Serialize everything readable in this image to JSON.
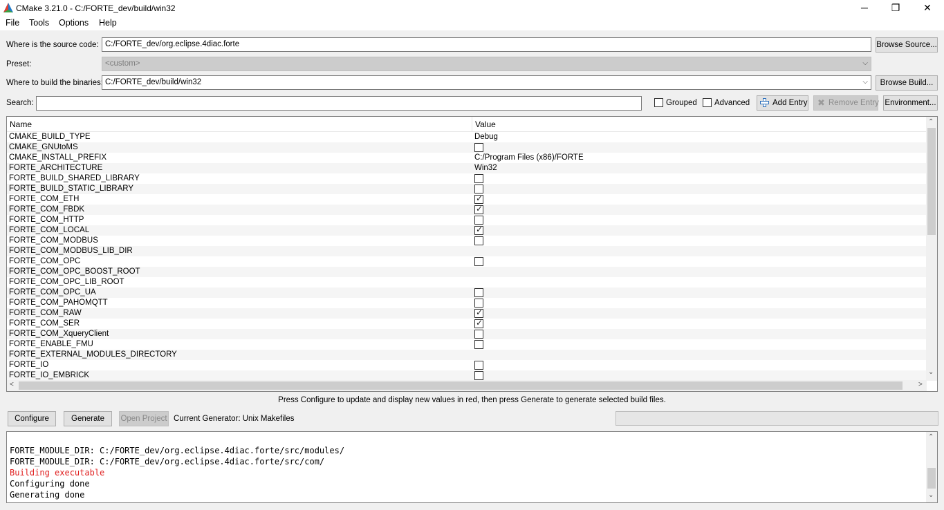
{
  "window": {
    "title": "CMake 3.21.0 - C:/FORTE_dev/build/win32"
  },
  "menu": [
    "File",
    "Tools",
    "Options",
    "Help"
  ],
  "source": {
    "label": "Where is the source code:",
    "value": "C:/FORTE_dev/org.eclipse.4diac.forte",
    "button": "Browse Source..."
  },
  "preset": {
    "label": "Preset:",
    "value": "<custom>"
  },
  "build": {
    "label": "Where to build the binaries:",
    "value": "C:/FORTE_dev/build/win32",
    "button": "Browse Build..."
  },
  "search": {
    "label": "Search:",
    "value": ""
  },
  "toolbar": {
    "grouped": "Grouped",
    "advanced": "Advanced",
    "add_entry": "Add Entry",
    "remove_entry": "Remove Entry",
    "environment": "Environment..."
  },
  "table": {
    "headers": {
      "name": "Name",
      "value": "Value"
    },
    "rows": [
      {
        "name": "CMAKE_BUILD_TYPE",
        "value": "Debug"
      },
      {
        "name": "CMAKE_GNUtoMS",
        "check": false
      },
      {
        "name": "CMAKE_INSTALL_PREFIX",
        "value": "C:/Program Files (x86)/FORTE"
      },
      {
        "name": "FORTE_ARCHITECTURE",
        "value": "Win32"
      },
      {
        "name": "FORTE_BUILD_SHARED_LIBRARY",
        "check": false
      },
      {
        "name": "FORTE_BUILD_STATIC_LIBRARY",
        "check": false
      },
      {
        "name": "FORTE_COM_ETH",
        "check": true
      },
      {
        "name": "FORTE_COM_FBDK",
        "check": true
      },
      {
        "name": "FORTE_COM_HTTP",
        "check": false
      },
      {
        "name": "FORTE_COM_LOCAL",
        "check": true
      },
      {
        "name": "FORTE_COM_MODBUS",
        "check": false
      },
      {
        "name": "FORTE_COM_MODBUS_LIB_DIR",
        "value": ""
      },
      {
        "name": "FORTE_COM_OPC",
        "check": false
      },
      {
        "name": "FORTE_COM_OPC_BOOST_ROOT",
        "value": ""
      },
      {
        "name": "FORTE_COM_OPC_LIB_ROOT",
        "value": ""
      },
      {
        "name": "FORTE_COM_OPC_UA",
        "check": false
      },
      {
        "name": "FORTE_COM_PAHOMQTT",
        "check": false
      },
      {
        "name": "FORTE_COM_RAW",
        "check": true
      },
      {
        "name": "FORTE_COM_SER",
        "check": true
      },
      {
        "name": "FORTE_COM_XqueryClient",
        "check": false
      },
      {
        "name": "FORTE_ENABLE_FMU",
        "check": false
      },
      {
        "name": "FORTE_EXTERNAL_MODULES_DIRECTORY",
        "value": ""
      },
      {
        "name": "FORTE_IO",
        "check": false
      },
      {
        "name": "FORTE_IO_EMBRICK",
        "check": false
      }
    ]
  },
  "hint": "Press Configure to update and display new values in red, then press Generate to generate selected build files.",
  "actions": {
    "configure": "Configure",
    "generate": "Generate",
    "open_project": "Open Project",
    "generator": "Current Generator: Unix Makefiles"
  },
  "log": [
    {
      "text": "FORTE_MODULE_DIR: C:/FORTE_dev/org.eclipse.4diac.forte/src/modules/",
      "error": false
    },
    {
      "text": "FORTE_MODULE_DIR: C:/FORTE_dev/org.eclipse.4diac.forte/src/com/",
      "error": false
    },
    {
      "text": "Building executable",
      "error": true
    },
    {
      "text": "Configuring done",
      "error": false
    },
    {
      "text": "Generating done",
      "error": false
    }
  ],
  "colors": {
    "error_text": "#e02020",
    "add_icon": "#2a6ebb"
  }
}
